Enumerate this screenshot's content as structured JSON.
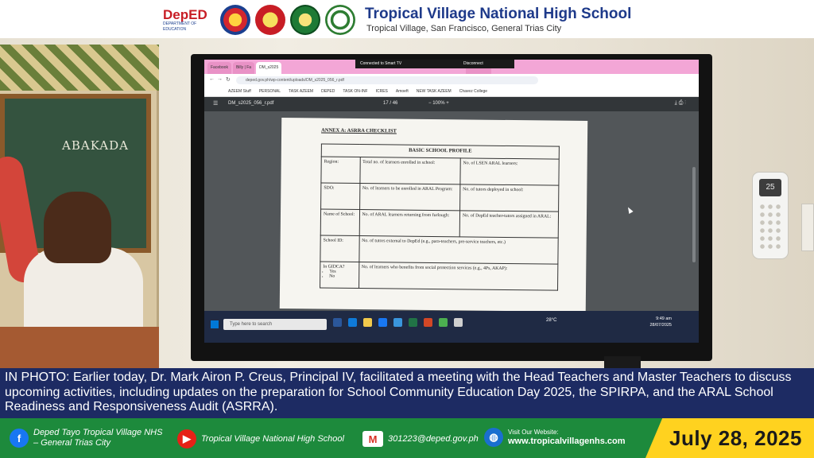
{
  "header": {
    "logo_text": "DepED",
    "logo_subtext": "DEPARTMENT OF EDUCATION",
    "school_name": "Tropical Village National High School",
    "school_address": "Tropical Village, San Francisco, General Trias City"
  },
  "screen": {
    "tabs": [
      "Facebook",
      "Billy | Fa",
      "DM_s2025",
      "ENROLLM"
    ],
    "notification": "Connected to Smart TV",
    "notification_action": "Disconnect",
    "url": "deped.gov.ph/wp-content/uploads/DM_s2025_056_r.pdf",
    "bookmarks": [
      "AZEEM Stuff",
      "PERSONAL",
      "TASK AZEEM",
      "DEPED",
      "TASK ON-INF",
      "ICRES",
      "Amoeft",
      "NEW TASK AZEEM",
      "Chavez College"
    ],
    "pdf": {
      "filename": "DM_s2025_056_r.pdf",
      "page": "17",
      "page_total": "/ 46",
      "zoom": "100%",
      "annex_title": "ANNEX A: ASRRA CHECKLIST",
      "table_title": "BASIC SCHOOL PROFILE",
      "rows": [
        [
          "Region:",
          "Total no. of learners enrolled in school:",
          "No. of LSEN ARAL learners:"
        ],
        [
          "SDO:",
          "No. of learners to be enrolled in ARAL Program:",
          "No. of tutors deployed in school:"
        ],
        [
          "Name of School:",
          "No. of ARAL learners returning from furlough:",
          "No. of DepEd teacher-tutors assigned in ARAL:"
        ],
        [
          "School ID:",
          "No. of tutors external to DepEd (e.g., para-teachers, pre-service teachers, etc.)",
          ""
        ],
        [
          "In GIDCA?",
          "No. of learners who benefits from social protection services (e.g., 4Ps, AKAP):",
          ""
        ]
      ],
      "gidca_options": [
        "Yes",
        "No"
      ]
    },
    "taskbar": {
      "search_placeholder": "Type here to search",
      "temperature": "28°C",
      "time": "9:49 am",
      "date": "28/07/2025"
    },
    "ac_display": "25"
  },
  "mural": {
    "chalk_text": "ABAKADA"
  },
  "caption": "IN PHOTO: Earlier today, Dr. Mark Airon P. Creus, Principal IV, facilitated a meeting with the Head Teachers and Master Teachers to discuss upcoming activities, including updates on the preparation for School Community Education Day 2025, the SPIRPA, and the ARAL School Readiness and Responsiveness Audit (ASRRA).",
  "footer": {
    "facebook_line1": "Deped Tayo Tropical Village NHS",
    "facebook_line2": "– General Trias City",
    "youtube": "Tropical Village National High School",
    "email": "301223@deped.gov.ph",
    "website_label": "Visit Our Website:",
    "website_url": "www.tropicalvillagenhs.com",
    "date": "July 28, 2025"
  },
  "colors": {
    "caption_band": "#1d2b63",
    "footer_green": "#1d8a3c",
    "date_yellow": "#ffd21f",
    "title_blue": "#1e3a8a"
  }
}
